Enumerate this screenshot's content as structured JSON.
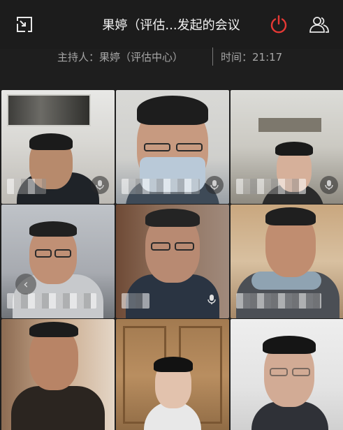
{
  "header": {
    "title": "果婷（评估...发起的会议",
    "shrink_icon": "minimize-window-icon",
    "leave_icon": "power-icon",
    "participants_icon": "participants-icon",
    "leave_color": "#e53935"
  },
  "meeting": {
    "host": "主持人：果婷（评估中心）",
    "time": "时间：21:17"
  },
  "tiles": [
    {
      "scene": "office-with-painting",
      "muted_mic_icon": "microphone-icon"
    },
    {
      "scene": "man-with-mask",
      "muted_mic_icon": "microphone-icon"
    },
    {
      "scene": "woman-living-room",
      "muted_mic_icon": "microphone-icon"
    },
    {
      "scene": "man-with-glasses-chair",
      "muted_mic_icon": "microphone-icon"
    },
    {
      "scene": "older-man-with-glasses",
      "muted_mic_icon": "microphone-icon"
    },
    {
      "scene": "man-in-jacket",
      "muted_mic_icon": "microphone-icon"
    },
    {
      "scene": "man-dark-jacket",
      "muted_mic_icon": "microphone-icon"
    },
    {
      "scene": "woman-wooden-door",
      "muted_mic_icon": "microphone-icon"
    },
    {
      "scene": "woman-with-glasses",
      "muted_mic_icon": "microphone-icon"
    }
  ],
  "nav": {
    "back_icon": "chevron-left-icon"
  }
}
